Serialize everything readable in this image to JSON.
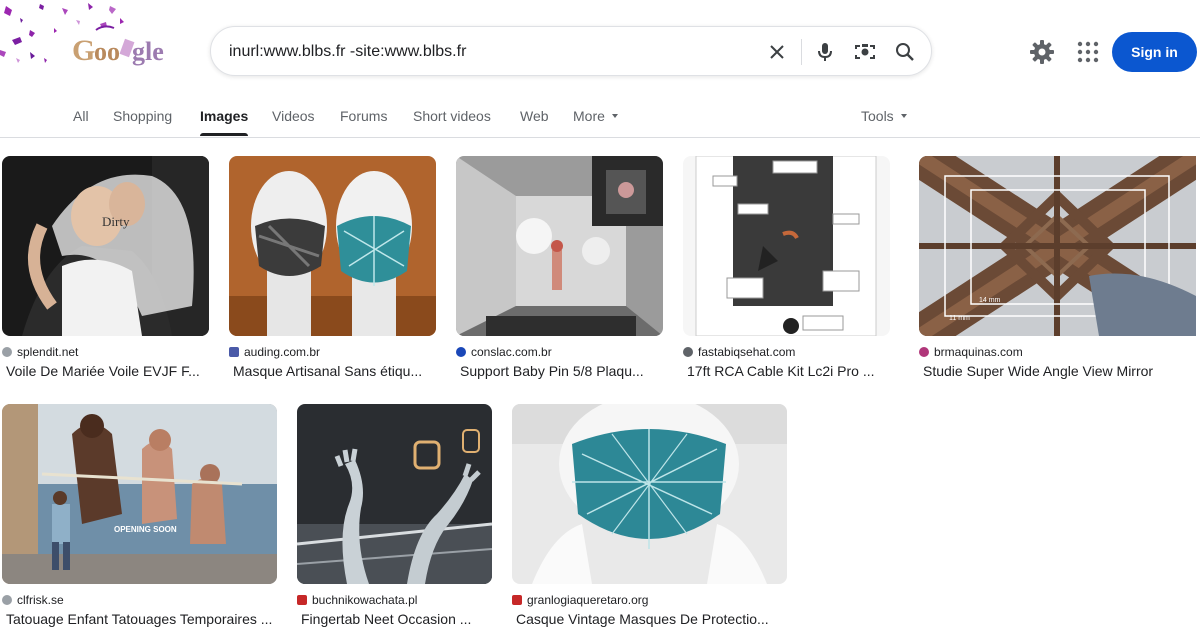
{
  "search": {
    "query": "inurl:www.blbs.fr -site:www.blbs.fr"
  },
  "header": {
    "logo_text": "Google",
    "sign_in_label": "Sign in"
  },
  "tabs": [
    {
      "label": "All"
    },
    {
      "label": "Shopping"
    },
    {
      "label": "Images"
    },
    {
      "label": "Videos"
    },
    {
      "label": "Forums"
    },
    {
      "label": "Short videos"
    },
    {
      "label": "Web"
    },
    {
      "label": "More"
    }
  ],
  "tools_label": "Tools",
  "results": [
    {
      "source": "splendit.net",
      "title": "Voile De Mariée Voile EVJF F..."
    },
    {
      "source": "auding.com.br",
      "title": "Masque Artisanal Sans étiqu..."
    },
    {
      "source": "conslac.com.br",
      "title": "Support Baby Pin 5/8 Plaqu..."
    },
    {
      "source": "fastabiqsehat.com",
      "title": "17ft RCA Cable Kit Lc2i Pro ..."
    },
    {
      "source": "brmaquinas.com",
      "title": "Studie Super Wide Angle View Mirror"
    },
    {
      "source": "clfrisk.se",
      "title": "Tatouage Enfant Tatouages Temporaires ..."
    },
    {
      "source": "buchnikowachata.pl",
      "title": "Fingertab Neet Occasion ..."
    },
    {
      "source": "granlogiaqueretaro.org",
      "title": "Casque Vintage Masques De Protectio..."
    }
  ],
  "image_text": {
    "veil_text": "Dirty",
    "banner_text": "OPENING SOON",
    "measure_a": "14 mm",
    "measure_b": "11 mm"
  },
  "colors": {
    "accent": "#0b57d0",
    "tab_active": "#202124",
    "tab_inactive": "#5f6368"
  }
}
